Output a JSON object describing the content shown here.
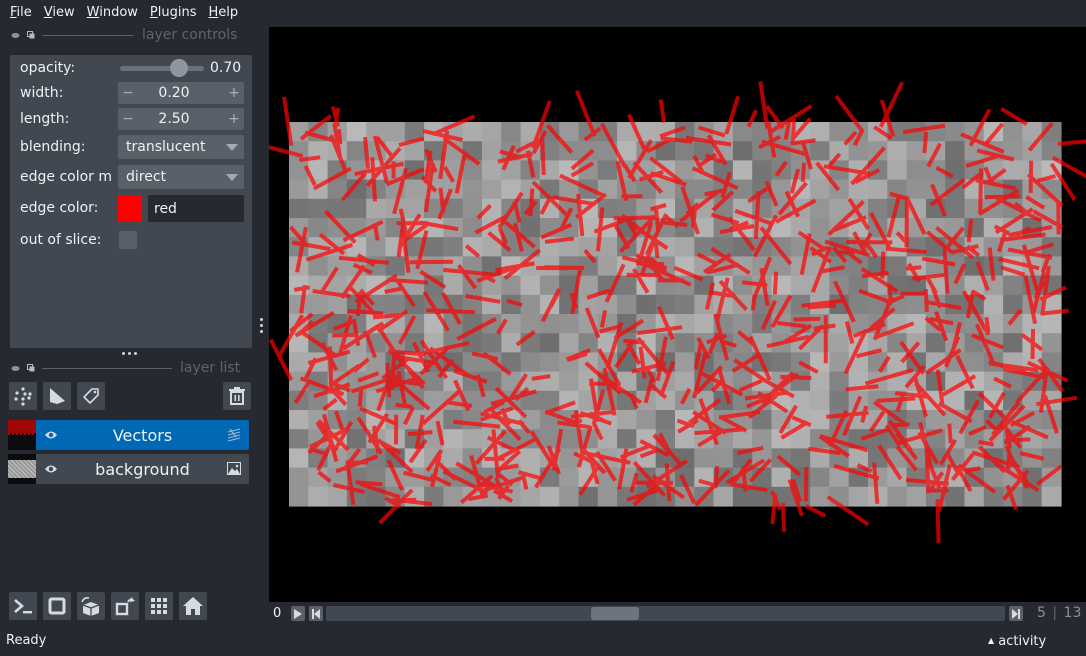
{
  "menu": {
    "items": [
      {
        "label": "File",
        "mnemonic": "F",
        "rest": "ile"
      },
      {
        "label": "View",
        "mnemonic": "V",
        "rest": "iew"
      },
      {
        "label": "Window",
        "mnemonic": "W",
        "rest": "indow"
      },
      {
        "label": "Plugins",
        "mnemonic": "P",
        "rest": "lugins"
      },
      {
        "label": "Help",
        "mnemonic": "H",
        "rest": "elp"
      }
    ]
  },
  "layer_controls": {
    "title": "layer controls",
    "opacity_label": "opacity:",
    "opacity_value": "0.70",
    "opacity_fraction": 0.7,
    "width_label": "width:",
    "width_value": "0.20",
    "length_label": "length:",
    "length_value": "2.50",
    "blending_label": "blending:",
    "blending_value": "translucent",
    "edge_color_mode_label": "edge color m",
    "edge_color_mode_value": "direct",
    "edge_color_label": "edge color:",
    "edge_color_value": "red",
    "edge_color_hex": "#ff0000",
    "out_of_slice_label": "out of slice:",
    "out_of_slice_checked": false,
    "minus_glyph": "−",
    "plus_glyph": "+"
  },
  "layer_list": {
    "title": "layer list",
    "tools": [
      "points-icon",
      "shapes-icon",
      "labels-icon"
    ],
    "delete": "delete-layer-icon",
    "layers": [
      {
        "name": "Vectors",
        "type": "vectors",
        "selected": true,
        "visible": true
      },
      {
        "name": "background",
        "type": "image",
        "selected": false,
        "visible": true
      }
    ]
  },
  "viewer_buttons": [
    "console-icon",
    "ndisplay-2d-icon",
    "roll-dims-icon",
    "transpose-dims-icon",
    "grid-icon",
    "home-icon"
  ],
  "dims": {
    "axis_label": "0",
    "current": "5",
    "separator": "|",
    "total": "13",
    "slider_fraction": 0.42
  },
  "status": {
    "text": "Ready",
    "activity_label": "activity",
    "activity_arrow": "▲"
  },
  "colors": {
    "accent": "#0068b4",
    "vector_color": "#ff0000",
    "panel": "#414851",
    "background": "#262930"
  },
  "scene": {
    "image_grid": [
      40,
      20
    ],
    "vector_count": 700,
    "vector_opacity": 0.7
  }
}
